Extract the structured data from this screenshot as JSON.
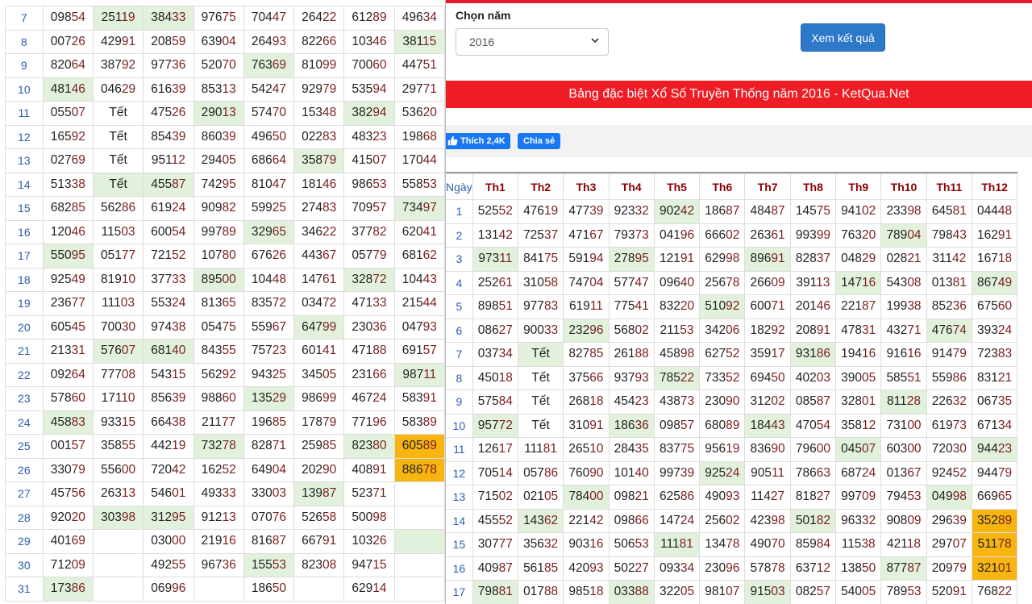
{
  "left_table": {
    "rows": [
      {
        "day": "7",
        "cells": [
          "09854",
          "25119",
          "38433",
          "97675",
          "70447",
          "26422",
          "61289",
          "49634"
        ],
        "hl": [
          "",
          "g",
          "g",
          "",
          "",
          "",
          "",
          ""
        ]
      },
      {
        "day": "8",
        "cells": [
          "00726",
          "42991",
          "20859",
          "63904",
          "26493",
          "82266",
          "10346",
          "38115"
        ],
        "hl": [
          "",
          "",
          "",
          "",
          "",
          "",
          "",
          "g"
        ]
      },
      {
        "day": "9",
        "cells": [
          "82064",
          "38792",
          "97736",
          "52070",
          "76369",
          "81099",
          "70060",
          "44751"
        ],
        "hl": [
          "",
          "",
          "",
          "",
          "g",
          "",
          "",
          ""
        ]
      },
      {
        "day": "10",
        "cells": [
          "48146",
          "04629",
          "61639",
          "85313",
          "54247",
          "92979",
          "53594",
          "29771"
        ],
        "hl": [
          "g",
          "",
          "",
          "",
          "",
          "",
          "",
          ""
        ]
      },
      {
        "day": "11",
        "cells": [
          "05507",
          "Tết",
          "47526",
          "29013",
          "57470",
          "15348",
          "38294",
          "53620"
        ],
        "hl": [
          "",
          "",
          "",
          "g",
          "",
          "",
          "g",
          ""
        ]
      },
      {
        "day": "12",
        "cells": [
          "16592",
          "Tết",
          "85439",
          "86039",
          "49650",
          "02283",
          "48323",
          "19868"
        ],
        "hl": [
          "",
          "",
          "",
          "",
          "",
          "",
          "",
          ""
        ]
      },
      {
        "day": "13",
        "cells": [
          "02769",
          "Tết",
          "95112",
          "29405",
          "68664",
          "35879",
          "41507",
          "17044"
        ],
        "hl": [
          "",
          "",
          "",
          "",
          "",
          "g",
          "",
          ""
        ]
      },
      {
        "day": "14",
        "cells": [
          "51338",
          "Tết",
          "45587",
          "74295",
          "81047",
          "18146",
          "98653",
          "55853"
        ],
        "hl": [
          "",
          "g",
          "g",
          "",
          "",
          "",
          "",
          ""
        ]
      },
      {
        "day": "15",
        "cells": [
          "68285",
          "56286",
          "61924",
          "90982",
          "59925",
          "27483",
          "70957",
          "73497"
        ],
        "hl": [
          "",
          "",
          "",
          "",
          "",
          "",
          "",
          "g"
        ]
      },
      {
        "day": "16",
        "cells": [
          "12046",
          "11503",
          "60054",
          "99789",
          "32965",
          "34622",
          "37782",
          "62041"
        ],
        "hl": [
          "",
          "",
          "",
          "",
          "g",
          "",
          "",
          ""
        ]
      },
      {
        "day": "17",
        "cells": [
          "55095",
          "05177",
          "72152",
          "10780",
          "67626",
          "44367",
          "05779",
          "68162"
        ],
        "hl": [
          "g",
          "",
          "",
          "",
          "",
          "",
          "",
          ""
        ]
      },
      {
        "day": "18",
        "cells": [
          "92549",
          "81910",
          "37733",
          "89500",
          "10448",
          "14761",
          "32872",
          "10443"
        ],
        "hl": [
          "",
          "",
          "",
          "g",
          "",
          "",
          "g",
          ""
        ]
      },
      {
        "day": "19",
        "cells": [
          "23677",
          "11103",
          "55324",
          "81365",
          "83572",
          "03472",
          "47133",
          "21544"
        ],
        "hl": [
          "",
          "",
          "",
          "",
          "",
          "",
          "",
          ""
        ]
      },
      {
        "day": "20",
        "cells": [
          "60545",
          "70030",
          "97438",
          "05475",
          "55967",
          "64799",
          "23036",
          "04793"
        ],
        "hl": [
          "",
          "",
          "",
          "",
          "",
          "g",
          "",
          ""
        ]
      },
      {
        "day": "21",
        "cells": [
          "21331",
          "57607",
          "68140",
          "84355",
          "75723",
          "60141",
          "47188",
          "69157"
        ],
        "hl": [
          "",
          "g",
          "g",
          "",
          "",
          "",
          "",
          ""
        ]
      },
      {
        "day": "22",
        "cells": [
          "09264",
          "77708",
          "54315",
          "56292",
          "94325",
          "34505",
          "23166",
          "98711"
        ],
        "hl": [
          "",
          "",
          "",
          "",
          "",
          "",
          "",
          "g"
        ]
      },
      {
        "day": "23",
        "cells": [
          "57860",
          "17110",
          "85639",
          "98860",
          "13529",
          "98699",
          "46724",
          "58391"
        ],
        "hl": [
          "",
          "",
          "",
          "",
          "g",
          "",
          "",
          ""
        ]
      },
      {
        "day": "24",
        "cells": [
          "45883",
          "93315",
          "66438",
          "21177",
          "19685",
          "17879",
          "77196",
          "58389"
        ],
        "hl": [
          "g",
          "",
          "",
          "",
          "",
          "",
          "",
          ""
        ]
      },
      {
        "day": "25",
        "cells": [
          "00157",
          "35855",
          "44219",
          "73278",
          "82871",
          "25985",
          "82380",
          "60589"
        ],
        "hl": [
          "",
          "",
          "",
          "g",
          "",
          "",
          "g",
          "o"
        ]
      },
      {
        "day": "26",
        "cells": [
          "33079",
          "55600",
          "72042",
          "16252",
          "64904",
          "20290",
          "40891",
          "88678"
        ],
        "hl": [
          "",
          "",
          "",
          "",
          "",
          "",
          "",
          "o"
        ]
      },
      {
        "day": "27",
        "cells": [
          "45756",
          "26313",
          "54601",
          "49333",
          "33003",
          "13987",
          "52371",
          ""
        ],
        "hl": [
          "",
          "",
          "",
          "",
          "",
          "g",
          "",
          ""
        ]
      },
      {
        "day": "28",
        "cells": [
          "92020",
          "30398",
          "31295",
          "91213",
          "07076",
          "52658",
          "50098",
          ""
        ],
        "hl": [
          "",
          "g",
          "g",
          "",
          "",
          "",
          "",
          ""
        ]
      },
      {
        "day": "29",
        "cells": [
          "40169",
          "",
          "03000",
          "21916",
          "81687",
          "66791",
          "10326",
          ""
        ],
        "hl": [
          "",
          "",
          "",
          "",
          "",
          "",
          "",
          "g"
        ]
      },
      {
        "day": "30",
        "cells": [
          "71209",
          "",
          "49255",
          "96736",
          "15553",
          "82308",
          "94715",
          ""
        ],
        "hl": [
          "",
          "",
          "",
          "",
          "g",
          "",
          "",
          ""
        ]
      },
      {
        "day": "31",
        "cells": [
          "17386",
          "",
          "06996",
          "",
          "18650",
          "",
          "62914",
          ""
        ],
        "hl": [
          "g",
          "",
          "",
          "",
          "",
          "",
          "",
          ""
        ]
      }
    ]
  },
  "right_panel": {
    "year_label": "Chọn năm",
    "year_value": "2016",
    "submit_label": "Xem kết quả",
    "banner_title": "Bảng đặc biệt Xổ Số Truyền Thống năm 2016 - KetQua.Net",
    "like_label": "Thích 2,4K",
    "share_label": "Chia sẻ",
    "table_header_day": "Ngày",
    "table_header_months": [
      "Th1",
      "Th2",
      "Th3",
      "Th4",
      "Th5",
      "Th6",
      "Th7",
      "Th8",
      "Th9",
      "Th10",
      "Th11",
      "Th12"
    ],
    "rows": [
      {
        "day": "1",
        "cells": [
          "52552",
          "47619",
          "47739",
          "92332",
          "90242",
          "18687",
          "48487",
          "14575",
          "94102",
          "23398",
          "64581",
          "04448"
        ],
        "hl": [
          "",
          "",
          "",
          "",
          "g",
          "",
          "",
          "",
          "",
          "",
          "",
          ""
        ]
      },
      {
        "day": "2",
        "cells": [
          "13142",
          "72537",
          "47167",
          "79373",
          "04196",
          "66602",
          "26361",
          "99399",
          "76320",
          "78904",
          "79843",
          "16291"
        ],
        "hl": [
          "",
          "",
          "",
          "",
          "",
          "",
          "",
          "",
          "",
          "g",
          "",
          ""
        ]
      },
      {
        "day": "3",
        "cells": [
          "97311",
          "84175",
          "59194",
          "27895",
          "12191",
          "62998",
          "89691",
          "82837",
          "04829",
          "02821",
          "31142",
          "16718"
        ],
        "hl": [
          "g",
          "",
          "",
          "g",
          "",
          "",
          "g",
          "",
          "",
          "",
          "",
          ""
        ]
      },
      {
        "day": "4",
        "cells": [
          "25261",
          "31058",
          "74704",
          "57747",
          "09640",
          "25678",
          "26609",
          "39113",
          "14716",
          "54308",
          "01381",
          "86749"
        ],
        "hl": [
          "",
          "",
          "",
          "",
          "",
          "",
          "",
          "",
          "g",
          "",
          "",
          "g"
        ]
      },
      {
        "day": "5",
        "cells": [
          "89851",
          "97783",
          "61911",
          "77541",
          "83220",
          "51092",
          "60071",
          "20146",
          "22187",
          "19938",
          "85236",
          "67560"
        ],
        "hl": [
          "",
          "",
          "",
          "",
          "",
          "g",
          "",
          "",
          "",
          "",
          "",
          ""
        ]
      },
      {
        "day": "6",
        "cells": [
          "08627",
          "90033",
          "23296",
          "56802",
          "21153",
          "34206",
          "18292",
          "20891",
          "47831",
          "43271",
          "47674",
          "39324"
        ],
        "hl": [
          "",
          "",
          "g",
          "",
          "",
          "",
          "",
          "",
          "",
          "",
          "g",
          ""
        ]
      },
      {
        "day": "7",
        "cells": [
          "03734",
          "Tết",
          "82785",
          "26188",
          "45898",
          "62752",
          "35917",
          "93186",
          "19416",
          "91616",
          "91479",
          "72383"
        ],
        "hl": [
          "",
          "g",
          "",
          "",
          "",
          "",
          "",
          "g",
          "",
          "",
          "",
          ""
        ]
      },
      {
        "day": "8",
        "cells": [
          "45018",
          "Tết",
          "37566",
          "93793",
          "78522",
          "73352",
          "69450",
          "40203",
          "39005",
          "58551",
          "55986",
          "83121"
        ],
        "hl": [
          "",
          "",
          "",
          "",
          "g",
          "",
          "",
          "",
          "",
          "",
          "",
          ""
        ]
      },
      {
        "day": "9",
        "cells": [
          "57584",
          "Tết",
          "26818",
          "45423",
          "43873",
          "23090",
          "31202",
          "08587",
          "32801",
          "81128",
          "22632",
          "06735"
        ],
        "hl": [
          "",
          "",
          "",
          "",
          "",
          "",
          "",
          "",
          "",
          "g",
          "",
          ""
        ]
      },
      {
        "day": "10",
        "cells": [
          "95772",
          "Tết",
          "31091",
          "18636",
          "09857",
          "68089",
          "18443",
          "47054",
          "35812",
          "73100",
          "61973",
          "67134"
        ],
        "hl": [
          "g",
          "",
          "",
          "g",
          "",
          "",
          "g",
          "",
          "",
          "",
          "",
          ""
        ]
      },
      {
        "day": "11",
        "cells": [
          "12617",
          "11181",
          "26510",
          "28435",
          "83775",
          "95619",
          "83690",
          "79600",
          "04507",
          "60300",
          "72030",
          "94423"
        ],
        "hl": [
          "",
          "",
          "",
          "",
          "",
          "",
          "",
          "",
          "g",
          "",
          "",
          "g"
        ]
      },
      {
        "day": "12",
        "cells": [
          "70514",
          "05786",
          "76090",
          "10140",
          "99739",
          "92524",
          "90511",
          "78663",
          "68724",
          "01367",
          "92452",
          "94479"
        ],
        "hl": [
          "",
          "",
          "",
          "",
          "",
          "g",
          "",
          "",
          "",
          "",
          "",
          ""
        ]
      },
      {
        "day": "13",
        "cells": [
          "71502",
          "02105",
          "78400",
          "09821",
          "62586",
          "49093",
          "11427",
          "81827",
          "99709",
          "79453",
          "04998",
          "66965"
        ],
        "hl": [
          "",
          "",
          "g",
          "",
          "",
          "",
          "",
          "",
          "",
          "",
          "g",
          ""
        ]
      },
      {
        "day": "14",
        "cells": [
          "45552",
          "14362",
          "22142",
          "09866",
          "14724",
          "25602",
          "42398",
          "50182",
          "96332",
          "90809",
          "29639",
          "35289"
        ],
        "hl": [
          "",
          "g",
          "",
          "",
          "",
          "",
          "",
          "g",
          "",
          "",
          "",
          "o"
        ]
      },
      {
        "day": "15",
        "cells": [
          "30777",
          "35632",
          "90316",
          "50653",
          "11181",
          "13478",
          "49070",
          "85984",
          "11538",
          "42118",
          "29707",
          "51178"
        ],
        "hl": [
          "",
          "",
          "",
          "",
          "g",
          "",
          "",
          "",
          "",
          "",
          "",
          "o"
        ]
      },
      {
        "day": "16",
        "cells": [
          "40987",
          "56185",
          "42093",
          "50227",
          "09334",
          "23096",
          "57878",
          "63712",
          "13850",
          "87787",
          "20979",
          "32101"
        ],
        "hl": [
          "",
          "",
          "",
          "",
          "",
          "",
          "",
          "",
          "",
          "g",
          "",
          "o"
        ]
      },
      {
        "day": "17",
        "cells": [
          "79881",
          "01788",
          "98518",
          "03388",
          "32205",
          "98107",
          "91503",
          "08257",
          "54005",
          "78953",
          "52091",
          "76822"
        ],
        "hl": [
          "g",
          "",
          "",
          "g",
          "",
          "",
          "g",
          "",
          "",
          "",
          "",
          ""
        ]
      }
    ]
  },
  "colors": {
    "red": "#ee1c25",
    "blue_button": "#2d78c8",
    "facebook": "#1877f2",
    "green_highlight": "#e2f1dc",
    "orange_highlight": "#f7b512"
  }
}
